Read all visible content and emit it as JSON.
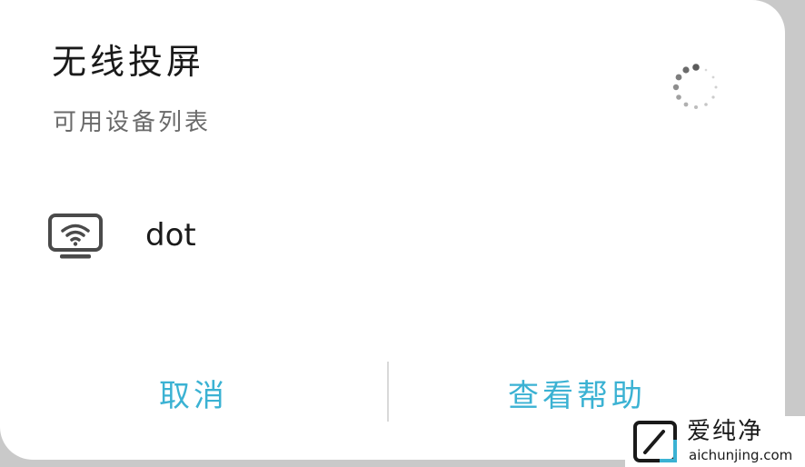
{
  "dialog": {
    "title": "无线投屏",
    "subtitle": "可用设备列表",
    "spinner_icon": "loading-spinner-icon"
  },
  "devices": [
    {
      "name": "dot",
      "icon": "wireless-display-icon"
    }
  ],
  "actions": {
    "cancel_label": "取消",
    "help_label": "查看帮助"
  },
  "watermark": {
    "brand": "爱纯净",
    "url": "aichunjing.com"
  },
  "colors": {
    "accent": "#3bb2d3",
    "text_primary": "#1a1a1a",
    "text_secondary": "#6a6a6a",
    "background": "#ffffff"
  }
}
